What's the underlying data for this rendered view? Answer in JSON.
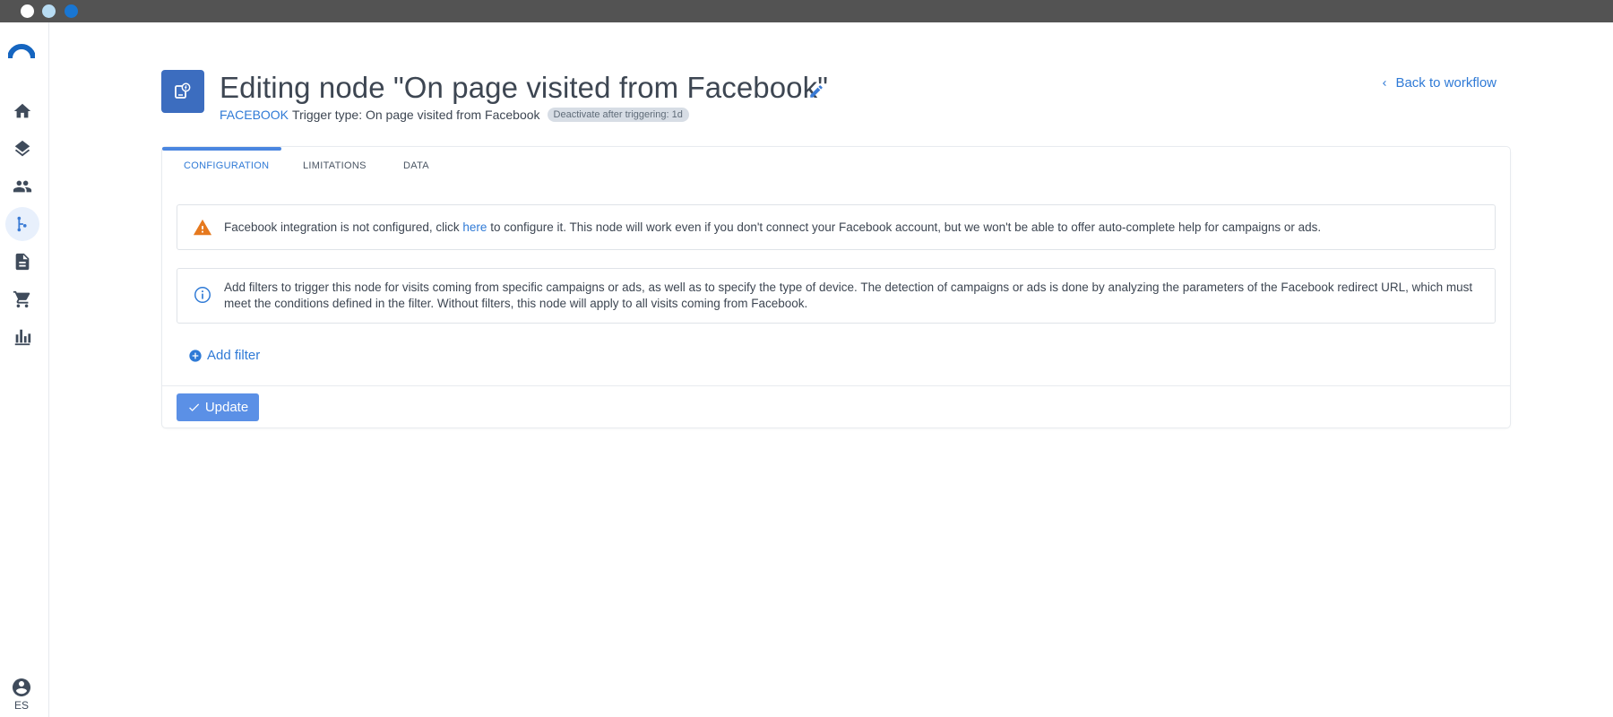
{
  "window": {
    "dots": [
      "close",
      "minimize",
      "maximize"
    ]
  },
  "sidebar": {
    "logo": "app-logo",
    "items": [
      {
        "name": "home",
        "icon": "home-icon"
      },
      {
        "name": "layers",
        "icon": "layers-icon"
      },
      {
        "name": "contacts",
        "icon": "people-icon"
      },
      {
        "name": "workflows",
        "icon": "workflow-branch-icon",
        "active": true
      },
      {
        "name": "documents",
        "icon": "document-icon"
      },
      {
        "name": "shop",
        "icon": "cart-icon"
      },
      {
        "name": "reports",
        "icon": "bar-chart-icon"
      }
    ],
    "user": {
      "icon": "account-circle-icon",
      "lang": "ES"
    }
  },
  "header": {
    "node_icon": "facebook-trigger-icon",
    "title": "Editing node \"On page visited from Facebook\"",
    "source_label": "FACEBOOK",
    "trigger_type": "Trigger type: On page visited from Facebook",
    "badge": "Deactivate after triggering: 1d",
    "back_link": "Back to workflow"
  },
  "tabs": [
    {
      "label": "CONFIGURATION",
      "active": true
    },
    {
      "label": "LIMITATIONS",
      "active": false
    },
    {
      "label": "DATA",
      "active": false
    }
  ],
  "warning": {
    "text_before": "Facebook integration is not configured, click ",
    "link": "here",
    "text_after": " to configure it. This node will work even if you don't connect your Facebook account, but we won't be able to offer auto-complete help for campaigns or ads."
  },
  "info": {
    "text": "Add filters to trigger this node for visits coming from specific campaigns or ads, as well as to specify the type of device. The detection of campaigns or ads is done by analyzing the parameters of the Facebook redirect URL, which must meet the conditions defined in the filter. Without filters, this node will apply to all visits coming from Facebook."
  },
  "actions": {
    "add_filter": "Add filter",
    "update": "Update"
  },
  "colors": {
    "accent": "#2f7ad6",
    "button": "#5b90e6",
    "warning": "#e6791e",
    "node_icon_bg": "#3c6dbf"
  }
}
